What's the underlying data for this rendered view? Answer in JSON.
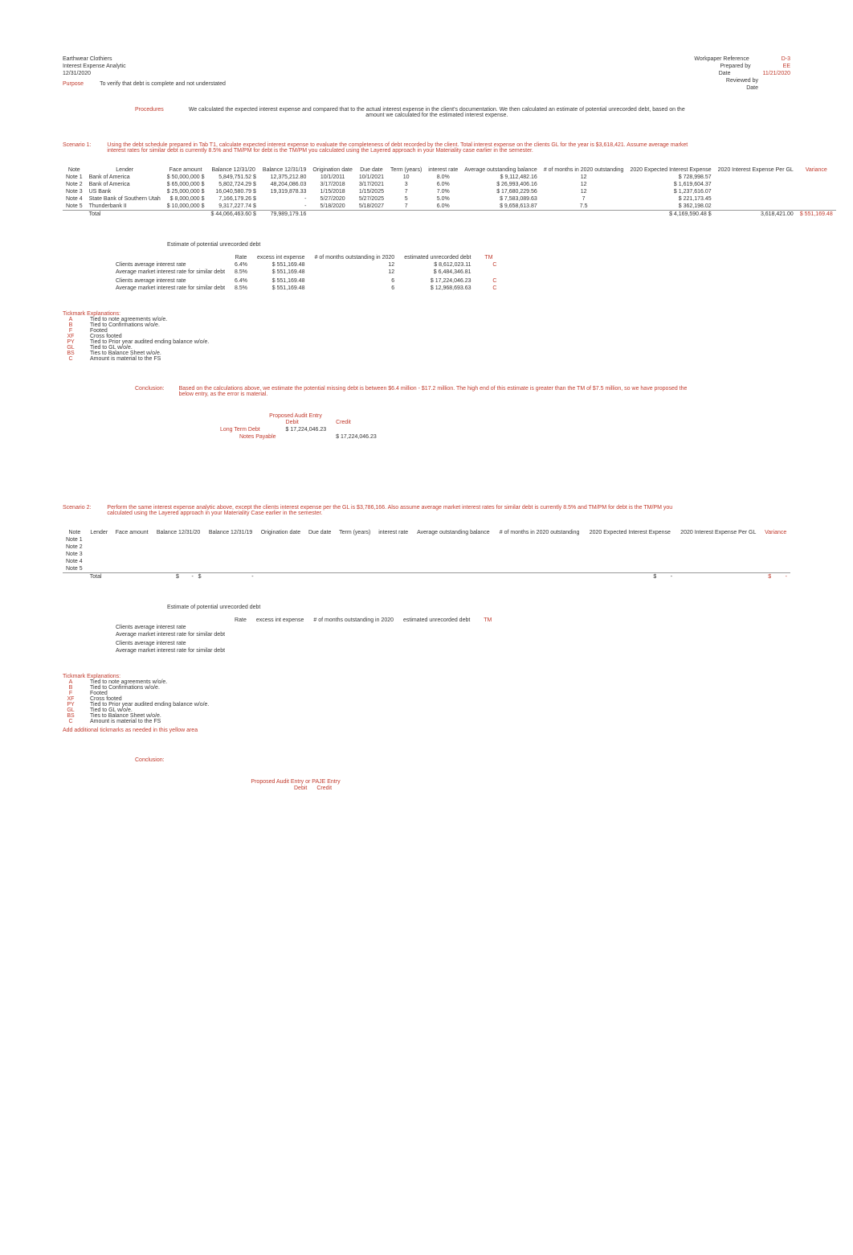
{
  "hdr": {
    "company": "Earthwear Clothiers",
    "title": "Interest Expense Analytic",
    "date": "12/31/2020",
    "purpose_label": "Purpose",
    "purpose_text": "To verify that debt is complete and not understated",
    "proc_label": "Procedures",
    "proc_text": "We calculated the expected interest expense and compared that to the actual interest expense in the client's documentation. We then calculated an estimate of potential unrecorded debt, based on the amount we calculated for the estimated interest expense.",
    "wr_label": "Workpaper Reference",
    "wr_value": "D-3",
    "prep_label": "Prepared by",
    "prep_value": "EE",
    "date_label": "Date",
    "date_value": "11/21/2020",
    "rev_label": "Reviewed by",
    "rev_date_label": "Date"
  },
  "s1": {
    "label": "Scenario 1:",
    "text": "Using the debt schedule prepared in Tab T1, calculate expected interest expense to evaluate the completeness of debt recorded by the client.         Total interest expense on the clients GL for the year is $3,618,421.   Assume average market interest rates for similar debt is currently 8.5% and TM/PM for debt is the TM/PM you calculated using the Layered approach in your Materiality case earlier in the semester.",
    "cols": [
      "Note",
      "Lender",
      "Face amount",
      "Balance 12/31/20",
      "Balance 12/31/19",
      "Origination date",
      "Due date",
      "Term (years)",
      "interest rate",
      "Average outstanding balance",
      "# of months in 2020 outstanding",
      "2020 Expected Interest Expense",
      "2020 Interest Expense Per GL",
      "Variance"
    ],
    "rows": [
      {
        "note": "Note 1",
        "lender": "Bank of America",
        "face": "50,000,000",
        "b20": "5,849,751.52",
        "b19": "12,375,212.80",
        "orig": "10/1/2011",
        "due": "10/1/2021",
        "term": "10",
        "rate": "8.0%",
        "avg": "9,112,482.16",
        "months": "12",
        "exp": "728,998.57"
      },
      {
        "note": "Note 2",
        "lender": "Bank of America",
        "face": "65,000,000",
        "b20": "5,802,724.29",
        "b19": "48,204,086.03",
        "orig": "3/17/2018",
        "due": "3/17/2021",
        "term": "3",
        "rate": "6.0%",
        "avg": "26,993,406.16",
        "months": "12",
        "exp": "1,619,604.37"
      },
      {
        "note": "Note 3",
        "lender": "US Bank",
        "face": "25,000,000",
        "b20": "16,040,580.79",
        "b19": "19,319,878.33",
        "orig": "1/15/2018",
        "due": "1/15/2025",
        "term": "7",
        "rate": "7.0%",
        "avg": "17,680,229.56",
        "months": "12",
        "exp": "1,237,616.07"
      },
      {
        "note": "Note 4",
        "lender": "State Bank of Southern Utah",
        "face": "8,000,000",
        "b20": "7,166,179.26",
        "b19": "-",
        "orig": "5/27/2020",
        "due": "5/27/2025",
        "term": "5",
        "rate": "5.0%",
        "avg": "7,583,089.63",
        "months": "7",
        "exp": "221,173.45"
      },
      {
        "note": "Note 5",
        "lender": "Thunderbank II",
        "face": "10,000,000",
        "b20": "9,317,227.74",
        "b19": "-",
        "orig": "5/18/2020",
        "due": "5/18/2027",
        "term": "7",
        "rate": "6.0%",
        "avg": "9,658,613.87",
        "months": "7.5",
        "exp": "362,198.02"
      }
    ],
    "tot_label": "Total",
    "tot_b20": "44,066,463.60",
    "tot_b19": "79,989,179.16",
    "tot_exp": "4,169,590.48",
    "tot_gl": "3,618,421.00",
    "tot_var": "551,169.48"
  },
  "est": {
    "title": "Estimate of potential unrecorded debt",
    "h_rate": "Rate",
    "h_excess": "excess int expense",
    "h_months": "# of months outstanding in 2020",
    "h_debt": "estimated unrecorded debt",
    "h_tm": "TM",
    "rows": [
      {
        "label": "Clients average interest rate",
        "rate": "6.4%",
        "ex": "551,169.48",
        "mon": "12",
        "debt": "8,612,023.11",
        "tm": "C"
      },
      {
        "label": "Average market interest rate for similar debt",
        "rate": "8.5%",
        "ex": "551,169.48",
        "mon": "12",
        "debt": "6,484,346.81",
        "tm": ""
      },
      {
        "label": "",
        "rate": "",
        "ex": "",
        "mon": "",
        "debt": "",
        "tm": ""
      },
      {
        "label": "Clients average interest rate",
        "rate": "6.4%",
        "ex": "551,169.48",
        "mon": "6",
        "debt": "17,224,046.23",
        "tm": "C"
      },
      {
        "label": "Average market interest rate for similar debt",
        "rate": "8.5%",
        "ex": "551,169.48",
        "mon": "6",
        "debt": "12,968,693.63",
        "tm": "C"
      }
    ]
  },
  "ticks": {
    "title": "Tickmark Explanations:",
    "rows": [
      {
        "c": "A",
        "t": "Tied to note agreements w/o/e."
      },
      {
        "c": "B",
        "t": "Tied to Confirmations w/o/e."
      },
      {
        "c": "F",
        "t": "Footed"
      },
      {
        "c": "XF",
        "t": "Cross footed"
      },
      {
        "c": "PY",
        "t": "Tied to Prior year audited ending balance w/o/e."
      },
      {
        "c": "GL",
        "t": "Tied to GL w/o/e."
      },
      {
        "c": "BS",
        "t": "Ties to Balance Sheet w/o/e."
      },
      {
        "c": "C",
        "t": "Amount is material to the FS"
      }
    ]
  },
  "concl1": {
    "label": "Conclusion:",
    "text": "Based on the calculations above, we estimate the potential missing debt is between $6.4 million - $17.2 million. The high end of this estimate is greater than the TM of $7.5 million, so we have proposed the below entry, as the error is material."
  },
  "entry1": {
    "title": "Proposed Audit Entry",
    "debit": "Debit",
    "credit": "Credit",
    "r1_label": "Long Term Debt",
    "r1_debit": "17,224,046.23",
    "r2_label": "Notes Payable",
    "r2_credit": "17,224,046.23"
  },
  "s2": {
    "label": "Scenario 2:",
    "text": "Perform the same interest expense analytic above, except the clients interest expense per the GL is $3,786,166.        Also assume average market interest rates for similar debt is currently 8.5% and TM/PM for debt is the TM/PM you calculated using the Layered approach in your Materiality Case earlier in the semester.",
    "cols": [
      "Note",
      "Lender",
      "Face amount",
      "Balance 12/31/20",
      "Balance 12/31/19",
      "Origination date",
      "Due date",
      "Term (years)",
      "interest rate",
      "Average outstanding balance",
      "# of months in 2020 outstanding",
      "2020 Expected Interest Expense",
      "2020 Interest Expense Per GL",
      "Variance"
    ],
    "notes": [
      "Note 1",
      "Note 2",
      "Note 3",
      "Note 4",
      "Note 5"
    ],
    "tot_label": "Total",
    "tot_sym1": "$",
    "tot_sym2": "$",
    "tot_dash": "-"
  },
  "est2": {
    "title": "Estimate of potential unrecorded debt",
    "rows": [
      {
        "label": "Clients average interest rate"
      },
      {
        "label": "Average market interest rate for similar debt"
      },
      {
        "label": ""
      },
      {
        "label": "Clients average interest rate"
      },
      {
        "label": "Average market interest rate for similar debt"
      }
    ]
  },
  "ticks2_extra": "Add additional tickmarks as needed in this yellow area",
  "concl2_label": "Conclusion:",
  "entry2_title": "Proposed Audit Entry or PAJE Entry",
  "entry2_debit": "Debit",
  "entry2_credit": "Credit"
}
